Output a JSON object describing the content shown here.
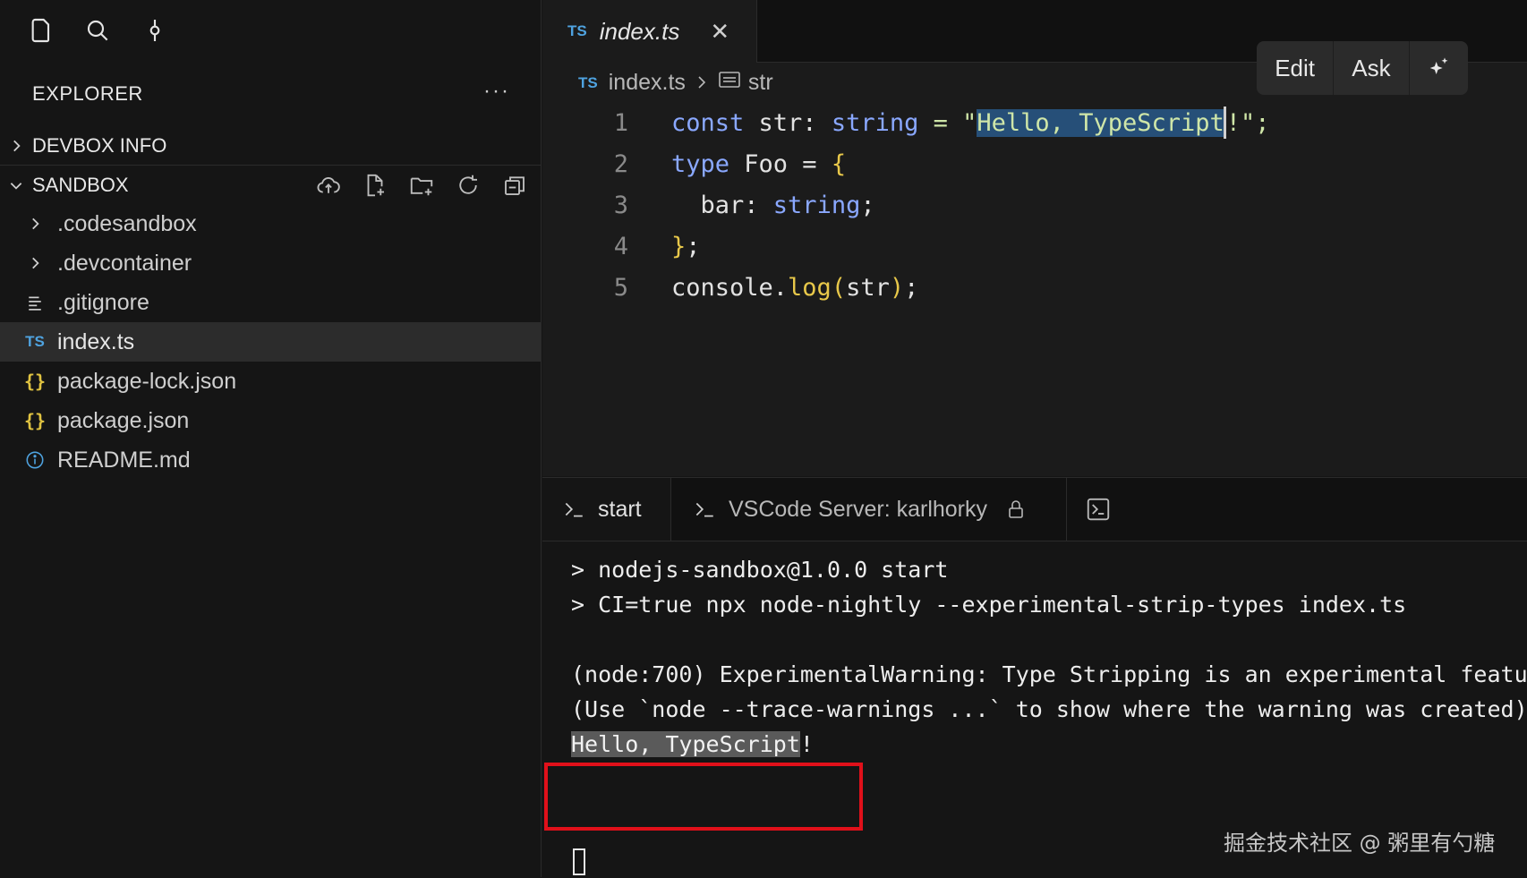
{
  "sidebar": {
    "title": "EXPLORER",
    "more": "···",
    "devbox_label": "DEVBOX INFO",
    "sandbox_label": "SANDBOX",
    "files": [
      {
        "label": ".codesandbox",
        "kind": "folder"
      },
      {
        "label": ".devcontainer",
        "kind": "folder"
      },
      {
        "label": ".gitignore",
        "kind": "text"
      },
      {
        "label": "index.ts",
        "kind": "ts",
        "badge": "TS",
        "selected": true
      },
      {
        "label": "package-lock.json",
        "kind": "json",
        "badge": "{}"
      },
      {
        "label": "package.json",
        "kind": "json",
        "badge": "{}"
      },
      {
        "label": "README.md",
        "kind": "info"
      }
    ]
  },
  "editor": {
    "tab": {
      "badge": "TS",
      "label": "index.ts"
    },
    "breadcrumb": {
      "badge": "TS",
      "file": "index.ts",
      "symbol": "str"
    },
    "ai_toolbar": {
      "edit": "Edit",
      "ask": "Ask"
    },
    "code_lines": [
      {
        "n": "1",
        "t1": "const",
        "t2": " str: ",
        "t3": "string",
        "t4": " = \"",
        "t5": "Hello, TypeScript",
        "t6": "!\";"
      },
      {
        "n": "2",
        "t1": "type",
        "t2": " Foo = ",
        "t3": "{"
      },
      {
        "n": "3",
        "t1": "  bar: ",
        "t2": "string",
        "t3": ";"
      },
      {
        "n": "4",
        "t1": "}",
        "t2": ";"
      },
      {
        "n": "5",
        "t1": "console.",
        "t2": "log",
        "t3": "(",
        "t4": "str",
        "t5": ")",
        "t6": ";"
      }
    ]
  },
  "terminal": {
    "tabs": {
      "start": "start",
      "server": "VSCode Server: karlhorky"
    },
    "lines": [
      "> nodejs-sandbox@1.0.0 start",
      "> CI=true npx node-nightly --experimental-strip-types index.ts",
      "(node:700) ExperimentalWarning: Type Stripping is an experimental featu",
      "(Use `node --trace-warnings ...` to show where the warning was created)"
    ],
    "output_hl": "Hello, TypeScript",
    "output_tail": "!"
  },
  "watermark": "掘金技术社区 @ 粥里有勺糖",
  "colors": {
    "accent_ts": "#4fa3e0",
    "json": "#e0c341",
    "highlight_box": "#e0101a",
    "selection": "#264f78"
  }
}
